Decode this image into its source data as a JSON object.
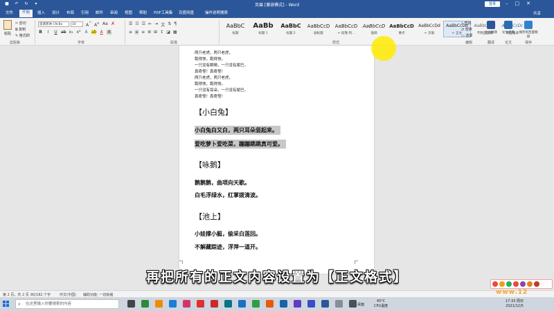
{
  "titlebar": {
    "title": "页眉 [兼容模式] - Word",
    "login": "登录",
    "icons": [
      "save-icon",
      "undo-icon",
      "redo-icon"
    ]
  },
  "tabs": [
    "文件",
    "开始",
    "插入",
    "设计",
    "布局",
    "引用",
    "邮件",
    "审阅",
    "视图",
    "帮助",
    "PDF工具集",
    "百度网盘",
    "操作说明搜索"
  ],
  "active_tab": "开始",
  "share": "共享",
  "ribbon": {
    "clipboard": {
      "paste": "粘贴",
      "cut": "剪切",
      "copy": "复制",
      "format_painter": "格式刷",
      "label": "剪贴板"
    },
    "font": {
      "name": "思源黑体 CN Bo",
      "size": "16",
      "label": "字体"
    },
    "paragraph": {
      "label": "段落"
    },
    "styles": {
      "label": "样式",
      "items": [
        {
          "sample": "AaBbC",
          "name": "标题"
        },
        {
          "sample": "AaBb",
          "name": "标题 1"
        },
        {
          "sample": "AaBbC",
          "name": "标题 2"
        },
        {
          "sample": "AaBbCcD",
          "name": "副标题"
        },
        {
          "sample": "AaBbCcD",
          "name": "↵ 段落-列..."
        },
        {
          "sample": "AaBbCcD",
          "name": "强调"
        },
        {
          "sample": "AaBbCcD",
          "name": "要点"
        },
        {
          "sample": "AaBbCcDd",
          "name": "↵ 页眉"
        },
        {
          "sample": "AaBbCcDd",
          "name": "↵ 正文"
        },
        {
          "sample": "AaBbCcDc",
          "name": "不明显强调"
        },
        {
          "sample": "AaBbCcDc",
          "name": "明显强调"
        }
      ],
      "selected": 8
    },
    "editing": {
      "find": "查找",
      "replace": "替换",
      "select": "选择",
      "label": "编辑"
    },
    "right": [
      {
        "label": "全文翻译",
        "color": "#2b579a"
      },
      {
        "label": "论文查重",
        "color": "#2b6cb0"
      },
      {
        "label": "保存到百度网盘",
        "color": "#3182ce"
      }
    ],
    "right_labels": [
      "翻译",
      "论文",
      "保存"
    ]
  },
  "document": {
    "small_lines": [
      "两只老虎，两只老虎，",
      "跑得快，跑得快。",
      "一只没有眼睛，一只没有尾巴，",
      "真奇怪！真奇怪！",
      "两只老虎，两只老虎，",
      "跑得快，跑得快。",
      "一只没有耳朵，一只没有尾巴，",
      "真奇怪！真奇怪！"
    ],
    "sections": [
      {
        "heading": "【小白兔】",
        "lines": [
          "小白兔白又白，两只耳朵竖起来。",
          "爱吃萝卜爱吃菜，蹦蹦跳跳真可爱。"
        ],
        "highlight": true
      },
      {
        "heading": "【咏鹅】",
        "lines": [
          "鹅鹅鹅，曲项向天歌。",
          "白毛浮绿水，红掌拨清波。"
        ],
        "highlight": false
      },
      {
        "heading": "【池上】",
        "lines": [
          "小娃撑小艇，偷采白莲回。",
          "不解藏踪迹，浮萍一道开。"
        ],
        "highlight": false
      }
    ]
  },
  "subtitle": "再把所有的正文内容设置为【正文格式】",
  "statusbar": {
    "page": "第 2 页，共 2 页",
    "words": "80/182 个字",
    "lang": "中文(中国)",
    "accessibility": "辅助功能: 一切就绪",
    "zoom": "100%"
  },
  "taskbar": {
    "search_placeholder": "在这里输入你要搜索的内容",
    "desktop": "桌面",
    "weather": "45°C",
    "cpu": "CPU温度",
    "time": "17:33 周日",
    "date": "2021/12/5",
    "app_colors": [
      "#444444",
      "#2b8a3e",
      "#f08c00",
      "#1c7ed6",
      "#d6336c",
      "#e03131",
      "#c92a2a",
      "#0b7285",
      "#1971c2",
      "#2f9e44",
      "#e8590c",
      "#1864ab",
      "#5f3dc4",
      "#364fc7",
      "#2b579a",
      "#868e96",
      "#495057"
    ]
  },
  "watermark": "www.12"
}
